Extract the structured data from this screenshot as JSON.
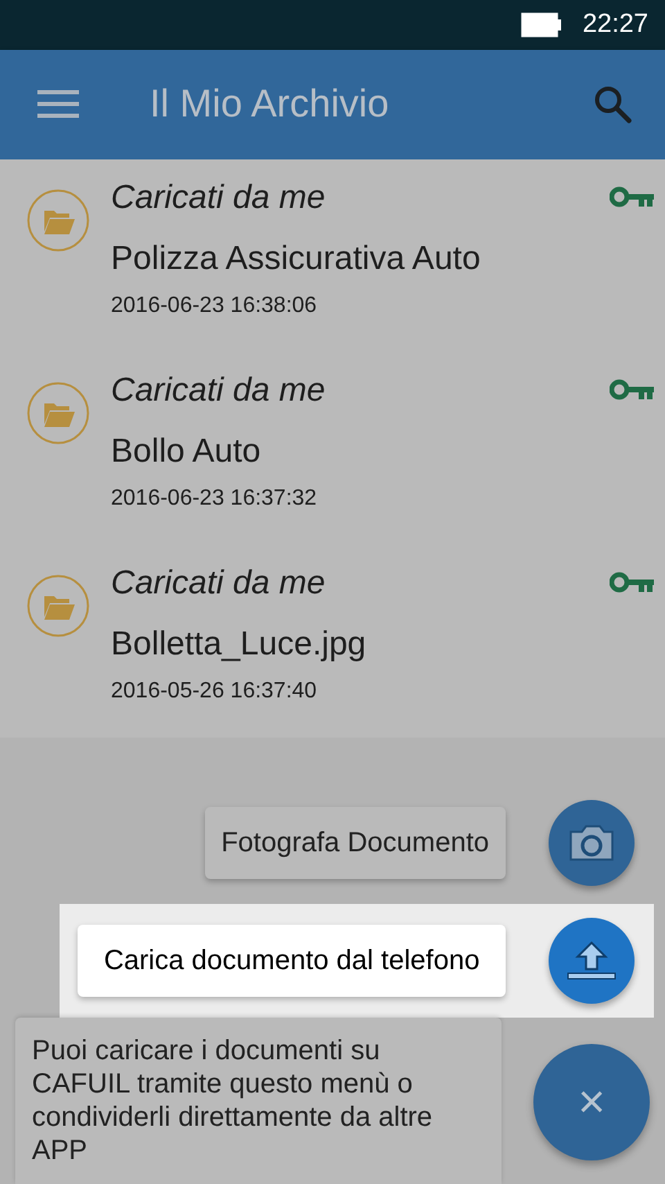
{
  "status_bar": {
    "time": "22:27"
  },
  "app_bar": {
    "title": "Il Mio Archivio"
  },
  "files": [
    {
      "folder": "Caricati da me",
      "name": "Polizza Assicurativa Auto",
      "date": "2016-06-23 16:38:06"
    },
    {
      "folder": "Caricati da me",
      "name": "Bollo Auto",
      "date": "2016-06-23 16:37:32"
    },
    {
      "folder": "Caricati da me",
      "name": "Bolletta_Luce.jpg",
      "date": "2016-05-26 16:37:40"
    }
  ],
  "fab_actions": [
    {
      "kind": "camera",
      "label": "Fotografa Documento",
      "highlighted": false
    },
    {
      "kind": "upload",
      "label": "Carica documento dal telefono",
      "highlighted": true
    }
  ],
  "hint": {
    "text": "Puoi caricare i documenti su CAFUIL tramite questo menù o condividerli direttamente da altre APP"
  },
  "close_button": {
    "label": "×"
  }
}
